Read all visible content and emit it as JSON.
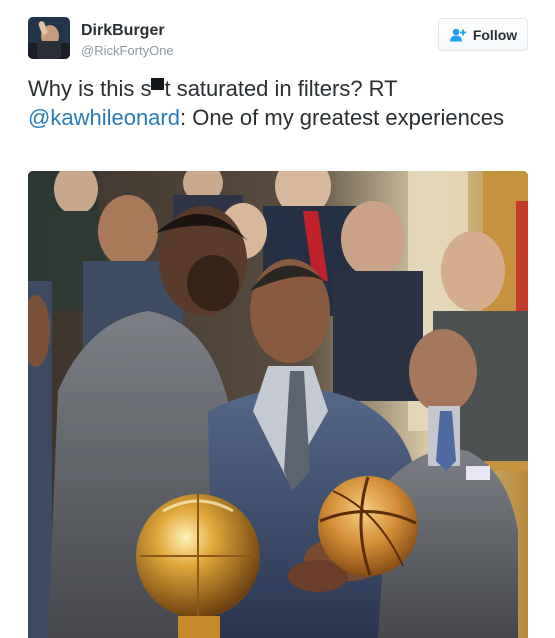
{
  "user": {
    "display_name": "DirkBurger",
    "handle": "@RickFortyOne",
    "avatar_icon": "user-avatar"
  },
  "follow_button": {
    "label": "Follow",
    "icon": "add-user-icon",
    "accent_color": "#1da1f2"
  },
  "tweet": {
    "text_part_1": "Why is this s",
    "text_part_2": "t saturated in filters? RT ",
    "mention": "@kawhileonard",
    "text_part_3": ": One of my greatest experiences",
    "mention_color": "#2b7bb9"
  },
  "media": {
    "kind": "photo"
  }
}
